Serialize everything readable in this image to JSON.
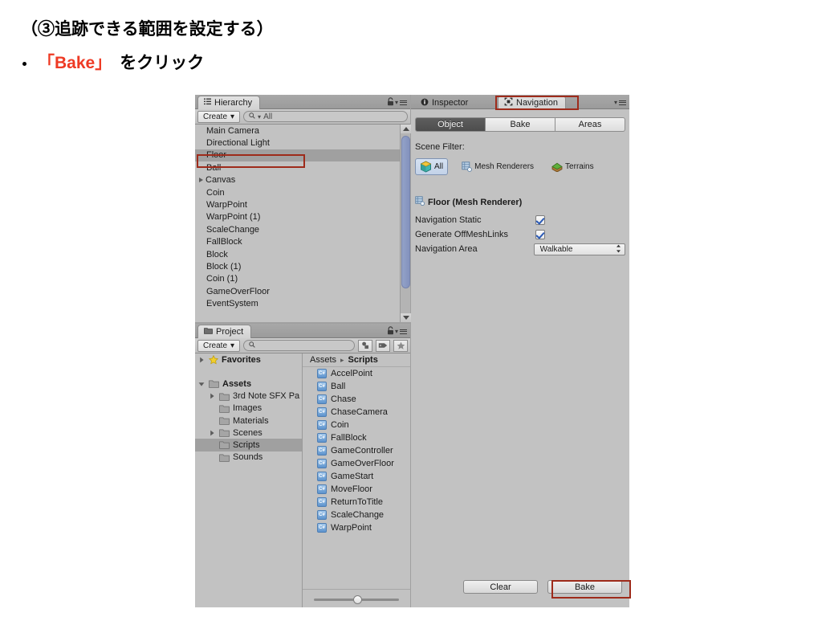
{
  "slide": {
    "title": "（③追跡できる範囲を設定する）",
    "bullet_prefix": "「Bake」",
    "bullet_suffix": "をクリック",
    "accent_color": "#ee3a24"
  },
  "hierarchy": {
    "tab_label": "Hierarchy",
    "tab_icon": "hierarchy-icon",
    "lock_icon": "lock-icon",
    "menu_icon": "panel-menu-icon",
    "create_label": "Create",
    "create_caret": "▾",
    "search_icon": "search-icon",
    "search_value": "All",
    "items": [
      {
        "label": "Main Camera",
        "expandable": false,
        "selected": false
      },
      {
        "label": "Directional Light",
        "expandable": false,
        "selected": false
      },
      {
        "label": "Floor",
        "expandable": false,
        "selected": true
      },
      {
        "label": "Ball",
        "expandable": false,
        "selected": false
      },
      {
        "label": "Canvas",
        "expandable": true,
        "selected": false
      },
      {
        "label": "Coin",
        "expandable": false,
        "selected": false
      },
      {
        "label": "WarpPoint",
        "expandable": false,
        "selected": false
      },
      {
        "label": "WarpPoint (1)",
        "expandable": false,
        "selected": false
      },
      {
        "label": "ScaleChange",
        "expandable": false,
        "selected": false
      },
      {
        "label": "FallBlock",
        "expandable": false,
        "selected": false
      },
      {
        "label": "Block",
        "expandable": false,
        "selected": false
      },
      {
        "label": "Block (1)",
        "expandable": false,
        "selected": false
      },
      {
        "label": "Coin (1)",
        "expandable": false,
        "selected": false
      },
      {
        "label": "GameOverFloor",
        "expandable": false,
        "selected": false
      },
      {
        "label": "EventSystem",
        "expandable": false,
        "selected": false
      }
    ]
  },
  "inspector": {
    "inspector_tab": "Inspector",
    "inspector_icon": "info-icon",
    "navigation_tab": "Navigation",
    "navigation_icon": "navigation-icon",
    "menu_icon": "panel-menu-icon",
    "active_tab": "Navigation",
    "mode_tabs": [
      {
        "label": "Object",
        "active": true
      },
      {
        "label": "Bake",
        "active": false
      },
      {
        "label": "Areas",
        "active": false
      }
    ],
    "scene_filter_label": "Scene Filter:",
    "filters": [
      {
        "label": "All",
        "icon": "cube-icon",
        "active": true
      },
      {
        "label": "Mesh Renderers",
        "icon": "mesh-renderer-icon",
        "active": false
      },
      {
        "label": "Terrains",
        "icon": "terrain-icon",
        "active": false
      }
    ],
    "object_header": "Floor (Mesh Renderer)",
    "object_header_icon": "mesh-renderer-icon",
    "properties": [
      {
        "label": "Navigation Static",
        "type": "checkbox",
        "checked": true
      },
      {
        "label": "Generate OffMeshLinks",
        "type": "checkbox",
        "checked": true
      },
      {
        "label": "Navigation Area",
        "type": "dropdown",
        "value": "Walkable"
      }
    ],
    "footer_buttons": [
      {
        "label": "Clear",
        "highlighted": false
      },
      {
        "label": "Bake",
        "highlighted": true
      }
    ]
  },
  "project": {
    "tab_label": "Project",
    "tab_icon": "folder-icon",
    "lock_icon": "lock-icon",
    "menu_icon": "panel-menu-icon",
    "create_label": "Create",
    "create_caret": "▾",
    "search_icon": "search-icon",
    "search_value": "",
    "filter_icons": [
      "type-filter-icon",
      "label-filter-icon",
      "favorite-star-icon"
    ],
    "tree": [
      {
        "label": "Favorites",
        "icon": "favorite-star-icon",
        "indent": 0,
        "expandable": true,
        "expanded": false,
        "bold": true,
        "selected": false
      },
      {
        "label": "",
        "icon": "",
        "indent": 0,
        "spacer": true
      },
      {
        "label": "Assets",
        "icon": "folder-icon",
        "indent": 0,
        "expandable": true,
        "expanded": true,
        "bold": true,
        "selected": false
      },
      {
        "label": "3rd Note SFX Pa",
        "icon": "folder-icon",
        "indent": 1,
        "expandable": true,
        "expanded": false,
        "bold": false,
        "selected": false
      },
      {
        "label": "Images",
        "icon": "folder-icon",
        "indent": 1,
        "expandable": false,
        "expanded": false,
        "bold": false,
        "selected": false
      },
      {
        "label": "Materials",
        "icon": "folder-icon",
        "indent": 1,
        "expandable": false,
        "expanded": false,
        "bold": false,
        "selected": false
      },
      {
        "label": "Scenes",
        "icon": "folder-icon",
        "indent": 1,
        "expandable": true,
        "expanded": false,
        "bold": false,
        "selected": false
      },
      {
        "label": "Scripts",
        "icon": "folder-icon",
        "indent": 1,
        "expandable": false,
        "expanded": false,
        "bold": false,
        "selected": true
      },
      {
        "label": "Sounds",
        "icon": "folder-icon",
        "indent": 1,
        "expandable": false,
        "expanded": false,
        "bold": false,
        "selected": false
      }
    ],
    "breadcrumb": [
      {
        "label": "Assets",
        "bold": false
      },
      {
        "label": "Scripts",
        "bold": true
      }
    ],
    "breadcrumb_separator": "▸",
    "assets": [
      {
        "label": "AccelPoint",
        "icon": "csharp-script-icon"
      },
      {
        "label": "Ball",
        "icon": "csharp-script-icon"
      },
      {
        "label": "Chase",
        "icon": "csharp-script-icon"
      },
      {
        "label": "ChaseCamera",
        "icon": "csharp-script-icon"
      },
      {
        "label": "Coin",
        "icon": "csharp-script-icon"
      },
      {
        "label": "FallBlock",
        "icon": "csharp-script-icon"
      },
      {
        "label": "GameController",
        "icon": "csharp-script-icon"
      },
      {
        "label": "GameOverFloor",
        "icon": "csharp-script-icon"
      },
      {
        "label": "GameStart",
        "icon": "csharp-script-icon"
      },
      {
        "label": "MoveFloor",
        "icon": "csharp-script-icon"
      },
      {
        "label": "ReturnToTitle",
        "icon": "csharp-script-icon"
      },
      {
        "label": "ScaleChange",
        "icon": "csharp-script-icon"
      },
      {
        "label": "WarpPoint",
        "icon": "csharp-script-icon"
      }
    ],
    "zoom_slider_name": "asset-zoom-slider"
  },
  "annotations": {
    "highlight_color": "#9e2b1b",
    "boxes": [
      "navigation-tab",
      "hierarchy-floor-item",
      "bake-button"
    ]
  }
}
